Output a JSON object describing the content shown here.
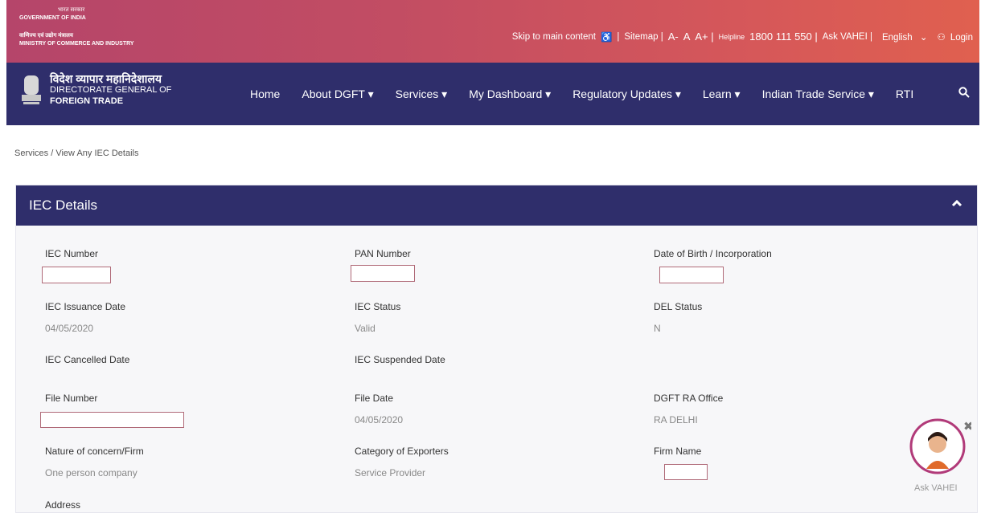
{
  "gov": {
    "hindi1": "भारत सरकार",
    "english1": "GOVERNMENT OF INDIA",
    "hindi2": "वाणिज्य एवं उद्योग मंत्रालय",
    "english2": "MINISTRY OF COMMERCE AND INDUSTRY"
  },
  "toplinks": {
    "skip": "Skip to main content",
    "sitemap": "Sitemap |",
    "a_minus": "A-",
    "a": "A",
    "a_plus": "A+ |",
    "helpline_label": "Helpline",
    "helpline_number": "1800 111 550 |",
    "ask": "Ask VAHEI |",
    "language": "English",
    "login": "Login"
  },
  "brand": {
    "hindi": "विदेश व्यापार महानिदेशालय",
    "english1": "DIRECTORATE GENERAL OF",
    "english2": "FOREIGN TRADE"
  },
  "menu": [
    "Home",
    "About DGFT ▾",
    "Services ▾",
    "My Dashboard ▾",
    "Regulatory Updates ▾",
    "Learn ▾",
    "Indian Trade Service ▾",
    "RTI"
  ],
  "breadcrumb": "Services / View Any IEC Details",
  "panel": {
    "title": "IEC Details",
    "fields": {
      "iec_number": "IEC Number",
      "pan_number": "PAN Number",
      "dob": "Date of Birth / Incorporation",
      "iec_issuance_date": "IEC Issuance Date",
      "iec_issuance_value": "04/05/2020",
      "iec_status": "IEC Status",
      "iec_status_value": "Valid",
      "del_status": "DEL Status",
      "del_status_value": "N",
      "iec_cancelled": "IEC Cancelled Date",
      "iec_suspended": "IEC Suspended Date",
      "file_number": "File Number",
      "file_date": "File Date",
      "file_date_value": "04/05/2020",
      "ra_office": "DGFT RA Office",
      "ra_office_value": "RA DELHI",
      "nature": "Nature of concern/Firm",
      "nature_value": "One person company",
      "category": "Category of Exporters",
      "category_value": "Service Provider",
      "firm_name": "Firm Name",
      "address": "Address"
    }
  },
  "vahei_label": "Ask VAHEI"
}
